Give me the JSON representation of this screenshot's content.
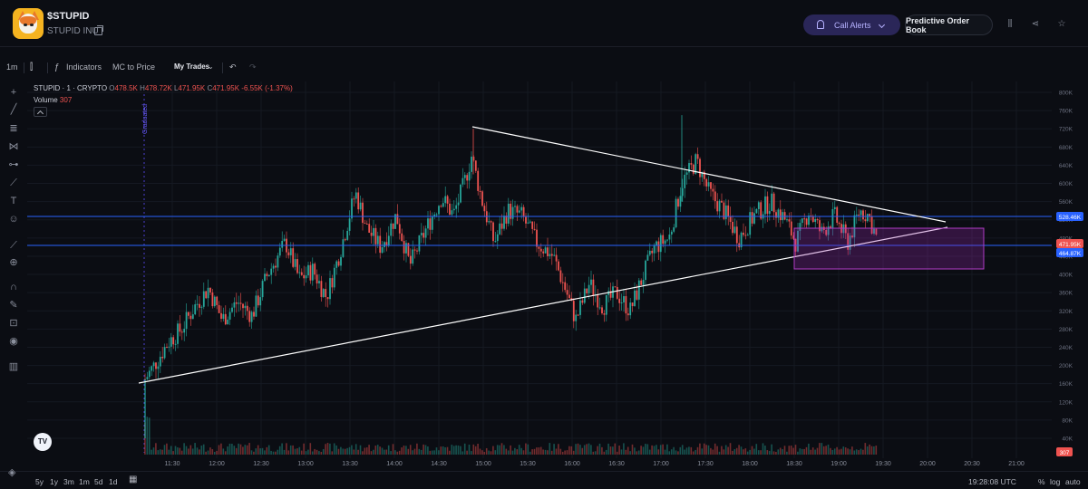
{
  "header": {
    "ticker": "$STUPID",
    "token_name": "STUPID INU",
    "call_alerts_label": "Call Alerts",
    "order_book_label": "Predictive Order Book"
  },
  "toolbar": {
    "interval": "1m",
    "indicators_label": "Indicators",
    "mc_to_price_label": "MC to Price",
    "my_trades_label": "My Trades"
  },
  "legend": {
    "symbol": "STUPID · 1 · CRYPTO",
    "open": "478.5K",
    "high": "478.72K",
    "low": "471.95K",
    "close": "471.95K",
    "change": "-6.55K (-1.37%)",
    "volume_label": "Volume",
    "volume_value": "307"
  },
  "chart": {
    "graduated_label": "Graduated",
    "y_ticks": [
      "800K",
      "760K",
      "720K",
      "680K",
      "640K",
      "600K",
      "560K",
      "520K",
      "480K",
      "440K",
      "400K",
      "360K",
      "320K",
      "280K",
      "240K",
      "200K",
      "160K",
      "120K",
      "80K",
      "40K"
    ],
    "x_ticks": [
      "11:30",
      "12:00",
      "12:30",
      "13:00",
      "13:30",
      "14:00",
      "14:30",
      "15:00",
      "15:30",
      "16:00",
      "16:30",
      "17:00",
      "17:30",
      "18:00",
      "18:30",
      "19:00",
      "19:30",
      "20:00",
      "20:30",
      "21:00"
    ],
    "price_labels": {
      "upper_line": "528.46K",
      "last_price": "471.95K",
      "lower_line": "464.87K",
      "volume_tag": "307"
    },
    "colors": {
      "up": "#26a69a",
      "down": "#ef5350",
      "hline": "#2962ff",
      "box": "#9c27b0"
    }
  },
  "bottom": {
    "ranges": [
      "5y",
      "1y",
      "3m",
      "1m",
      "5d",
      "1d"
    ],
    "time": "19:28:08 UTC",
    "percent": "%",
    "log": "log",
    "auto": "auto"
  },
  "icons": [
    "copy-icon",
    "bell-icon",
    "chevron-down-icon",
    "columns-icon",
    "share-icon",
    "star-icon",
    "candles-icon",
    "indicators-icon",
    "undo-icon",
    "redo-icon",
    "calendar-icon",
    "layers-icon"
  ]
}
